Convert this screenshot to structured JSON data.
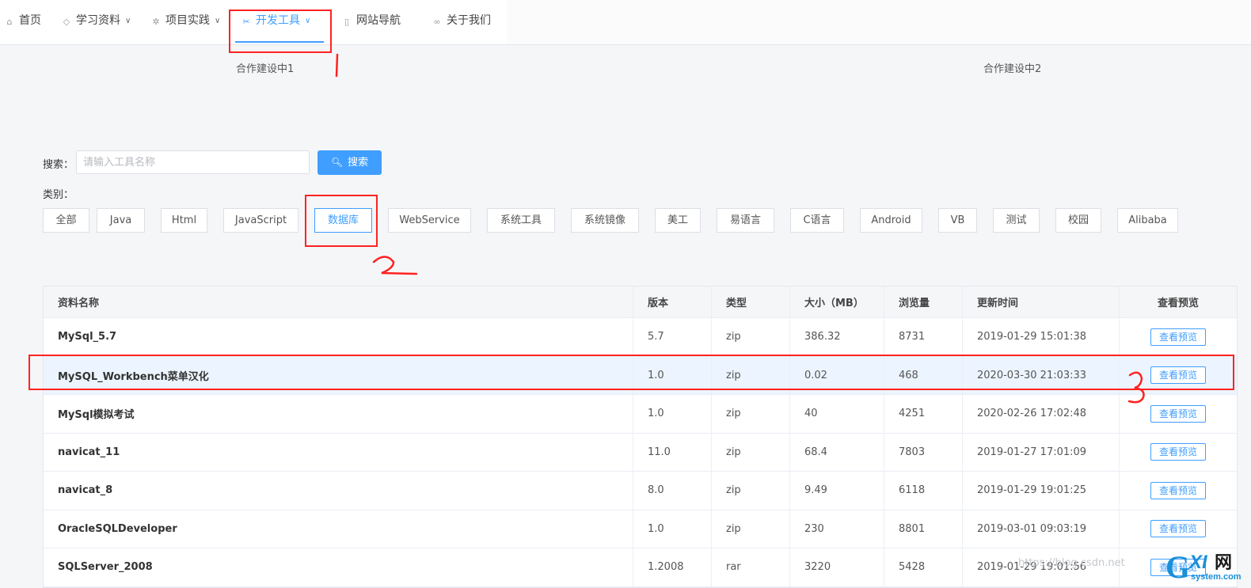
{
  "nav": {
    "items": [
      {
        "label": "首页",
        "icon": "home-icon"
      },
      {
        "label": "学习资料",
        "icon": "book-icon",
        "has_dropdown": true
      },
      {
        "label": "项目实践",
        "icon": "gear-icon",
        "has_dropdown": true
      },
      {
        "label": "开发工具",
        "icon": "tools-icon",
        "has_dropdown": true,
        "active": true
      },
      {
        "label": "网站导航",
        "icon": "document-icon"
      },
      {
        "label": "关于我们",
        "icon": "link-icon"
      }
    ]
  },
  "coop": {
    "left": "合作建设中1",
    "right": "合作建设中2"
  },
  "search": {
    "label": "搜索：",
    "placeholder": "请输入工具名称",
    "value": "",
    "button": "搜索"
  },
  "category": {
    "label": "类别：",
    "items": [
      "全部",
      "Java",
      "Html",
      "JavaScript",
      "数据库",
      "WebService",
      "系统工具",
      "系统镜像",
      "美工",
      "易语言",
      "C语言",
      "Android",
      "VB",
      "测试",
      "校园",
      "Alibaba"
    ],
    "selected": "数据库"
  },
  "table": {
    "headers": [
      "资料名称",
      "版本",
      "类型",
      "大小（MB）",
      "浏览量",
      "更新时间",
      "查看预览"
    ],
    "rows": [
      {
        "name": "MySql_5.7",
        "version": "5.7",
        "type": "zip",
        "size": "386.32",
        "views": "8731",
        "updated": "2019-01-29 15:01:38",
        "action": "查看预览"
      },
      {
        "name": "MySQL_Workbench菜单汉化",
        "version": "1.0",
        "type": "zip",
        "size": "0.02",
        "views": "468",
        "updated": "2020-03-30 21:03:33",
        "action": "查看预览",
        "highlight": true
      },
      {
        "name": "MySql模拟考试",
        "version": "1.0",
        "type": "zip",
        "size": "40",
        "views": "4251",
        "updated": "2020-02-26 17:02:48",
        "action": "查看预览"
      },
      {
        "name": "navicat_11",
        "version": "11.0",
        "type": "zip",
        "size": "68.4",
        "views": "7803",
        "updated": "2019-01-27 17:01:09",
        "action": "查看预览"
      },
      {
        "name": "navicat_8",
        "version": "8.0",
        "type": "zip",
        "size": "9.49",
        "views": "6118",
        "updated": "2019-01-29 19:01:25",
        "action": "查看预览"
      },
      {
        "name": "OracleSQLDeveloper",
        "version": "1.0",
        "type": "zip",
        "size": "230",
        "views": "8801",
        "updated": "2019-03-01 09:03:19",
        "action": "查看预览"
      },
      {
        "name": "SQLServer_2008",
        "version": "1.2008",
        "type": "rar",
        "size": "3220",
        "views": "5428",
        "updated": "2019-01-29 19:01:56",
        "action": "查看预览"
      }
    ]
  },
  "annotations": {
    "color": "#ff2222",
    "marks": [
      "1",
      "2",
      "3"
    ]
  },
  "watermark": "https://blog.csdn.net",
  "logo": {
    "text_g": "G",
    "text_xi": "XI",
    "text_wang": "网",
    "sub": "system.com"
  },
  "colors": {
    "accent": "#409eff",
    "annotation": "#ff2222",
    "background": "#f5f6f8"
  }
}
